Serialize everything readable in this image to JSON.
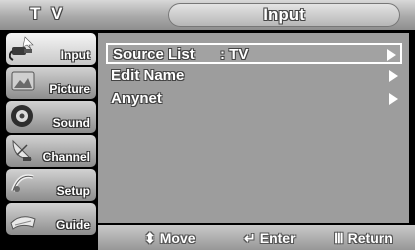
{
  "header": {
    "source": "T V",
    "title": "Input"
  },
  "sidebar": {
    "items": [
      {
        "label": "Input",
        "icon": "input-plug-icon",
        "active": true
      },
      {
        "label": "Picture",
        "icon": "picture-icon",
        "active": false
      },
      {
        "label": "Sound",
        "icon": "speaker-icon",
        "active": false
      },
      {
        "label": "Channel",
        "icon": "satellite-dish-icon",
        "active": false
      },
      {
        "label": "Setup",
        "icon": "setup-icon",
        "active": false
      },
      {
        "label": "Guide",
        "icon": "guide-icon",
        "active": false
      }
    ]
  },
  "menu": {
    "items": [
      {
        "label": "Source List",
        "value": ": TV",
        "selected": true
      },
      {
        "label": "Edit Name",
        "value": "",
        "selected": false
      },
      {
        "label": "Anynet",
        "value": "",
        "selected": false
      }
    ]
  },
  "footer": {
    "move_glyph": "⬍",
    "move_label": "Move",
    "enter_glyph": "↵",
    "enter_label": "Enter",
    "return_glyph": "Ⅲ",
    "return_label": "Return"
  }
}
